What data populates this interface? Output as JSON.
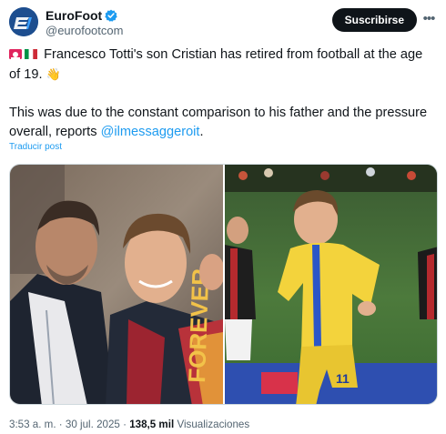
{
  "account": {
    "display_name": "EuroFoot",
    "handle": "@eurofootcom",
    "subscribe_label": "Suscribirse",
    "more_icon": "more-horizontal-icon",
    "verified_icon": "verified-badge-icon"
  },
  "tweet": {
    "paragraph_1": "Francesco Totti's son Cristian has retired from football at the age of 19.",
    "paragraph_2_before": "This was due to the constant comparison to his father and the pressure overall, reports ",
    "paragraph_2_mention": "@ilmessaggeroit",
    "paragraph_2_after": ".",
    "translate_label": "Traducir post"
  },
  "media": {
    "left_photo": "father-and-son-photo",
    "right_photo": "player-on-pitch-photo",
    "scarf_text": "FOREVER",
    "jersey_number": "11"
  },
  "meta": {
    "time": "3:53 a. m.",
    "separator": "·",
    "date": "30 jul. 2025",
    "views_count": "138,5 mil",
    "views_label": "Visualizaciones"
  },
  "colors": {
    "accent": "#1d9bf0",
    "text": "#0f1419",
    "secondary": "#536471",
    "button_bg": "#0f1419"
  }
}
